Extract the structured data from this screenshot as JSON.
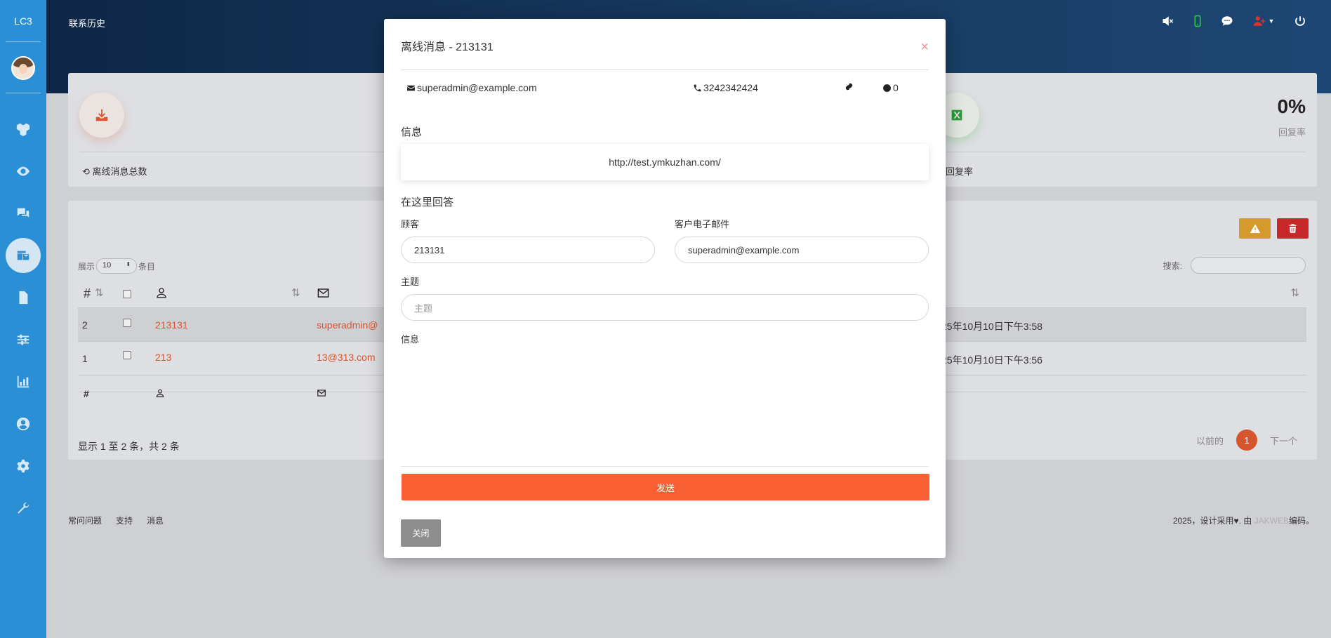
{
  "sidebar": {
    "brand": "LC3",
    "icons": [
      "cubes-icon",
      "eye-icon",
      "comments-icon",
      "mail-bulk-icon",
      "file-icon",
      "sliders-icon",
      "chart-icon",
      "user-circle-icon",
      "gear-icon",
      "wrench-icon"
    ],
    "active_index": 3
  },
  "header": {
    "title": "联系历史",
    "icons": [
      "volume-mute-icon",
      "mobile-icon",
      "chat-icon",
      "user-plus-icon",
      "power-icon"
    ]
  },
  "stats": {
    "left_label": "离线消息总数",
    "right_label": "回复率",
    "percent": "0%",
    "percent_label": "回复率"
  },
  "table": {
    "show_prefix": "展示",
    "show_value": "10",
    "show_suffix": "条目",
    "search_label": "搜索:",
    "header_hash": "#",
    "rows": [
      {
        "id": "2",
        "name": "213131",
        "email": "superadmin@",
        "date": "25年10月10日下午3:58"
      },
      {
        "id": "1",
        "name": "213",
        "email": "13@313.com",
        "date": "25年10月10日下午3:56"
      }
    ],
    "footer_hash": "#",
    "info": "显示 1 至 2 条，共 2 条",
    "prev": "以前的",
    "page": "1",
    "next": "下一个"
  },
  "footer": {
    "links": [
      "常问问题",
      "支持",
      "消息"
    ],
    "right_prefix": "2025，设计采用♥. 由 ",
    "right_brand": "JAKWEB",
    "right_suffix": "编码。"
  },
  "modal": {
    "title": "离线消息 - 213131",
    "close_symbol": "×",
    "email": "superadmin@example.com",
    "phone": "3242342424",
    "visits": "0",
    "message_section": "信息",
    "message_text": "http://test.ymkuzhan.com/",
    "reply_section": "在这里回答",
    "customer_label": "顾客",
    "customer_value": "213131",
    "email_label": "客户电子邮件",
    "email_value": "superadmin@example.com",
    "subject_label": "主题",
    "subject_placeholder": "主题",
    "message_label": "信息",
    "send_label": "发送",
    "close_label": "关闭"
  },
  "colors": {
    "sidebar": "#2b8fd6",
    "accent": "#f85f32",
    "link": "#d4552e"
  }
}
